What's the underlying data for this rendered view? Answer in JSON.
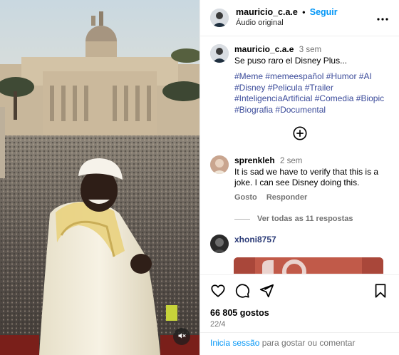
{
  "header": {
    "username": "mauricio_c.a.e",
    "separator": "•",
    "follow_label": "Seguir",
    "audio_label": "Áudio original"
  },
  "caption": {
    "username": "mauricio_c.a.e",
    "time": "3 sem",
    "text": "Se puso raro el Disney Plus...",
    "hashtags": [
      "#Meme",
      "#memeespañol",
      "#Humor",
      "#AI",
      "#Disney",
      "#Pelicula",
      "#Trailer",
      "#InteligenciaArtificial",
      "#Comedia",
      "#Biopic",
      "#Biografia",
      "#Documental"
    ]
  },
  "comments": [
    {
      "username": "sprenkleh",
      "time": "2 sem",
      "text": "It is sad we have to verify that this is a joke. I can see Disney doing this.",
      "like_label": "Gosto",
      "reply_label": "Responder",
      "replies_label": "Ver todas as 11 respostas"
    },
    {
      "username": "xhoni8757"
    }
  ],
  "actions": {
    "like_icon": "heart-icon",
    "comment_icon": "comment-icon",
    "share_icon": "share-icon",
    "save_icon": "bookmark-icon",
    "likes_text": "66 805 gostos",
    "date_text": "22/4"
  },
  "login_bar": {
    "link_label": "Inicia sessão",
    "text": " para gostar ou comentar"
  },
  "media": {
    "mute_icon": "speaker-muted-icon"
  },
  "colors": {
    "accent": "#0095f6",
    "hashtag": "#3b4b9a",
    "muted": "#737373"
  }
}
